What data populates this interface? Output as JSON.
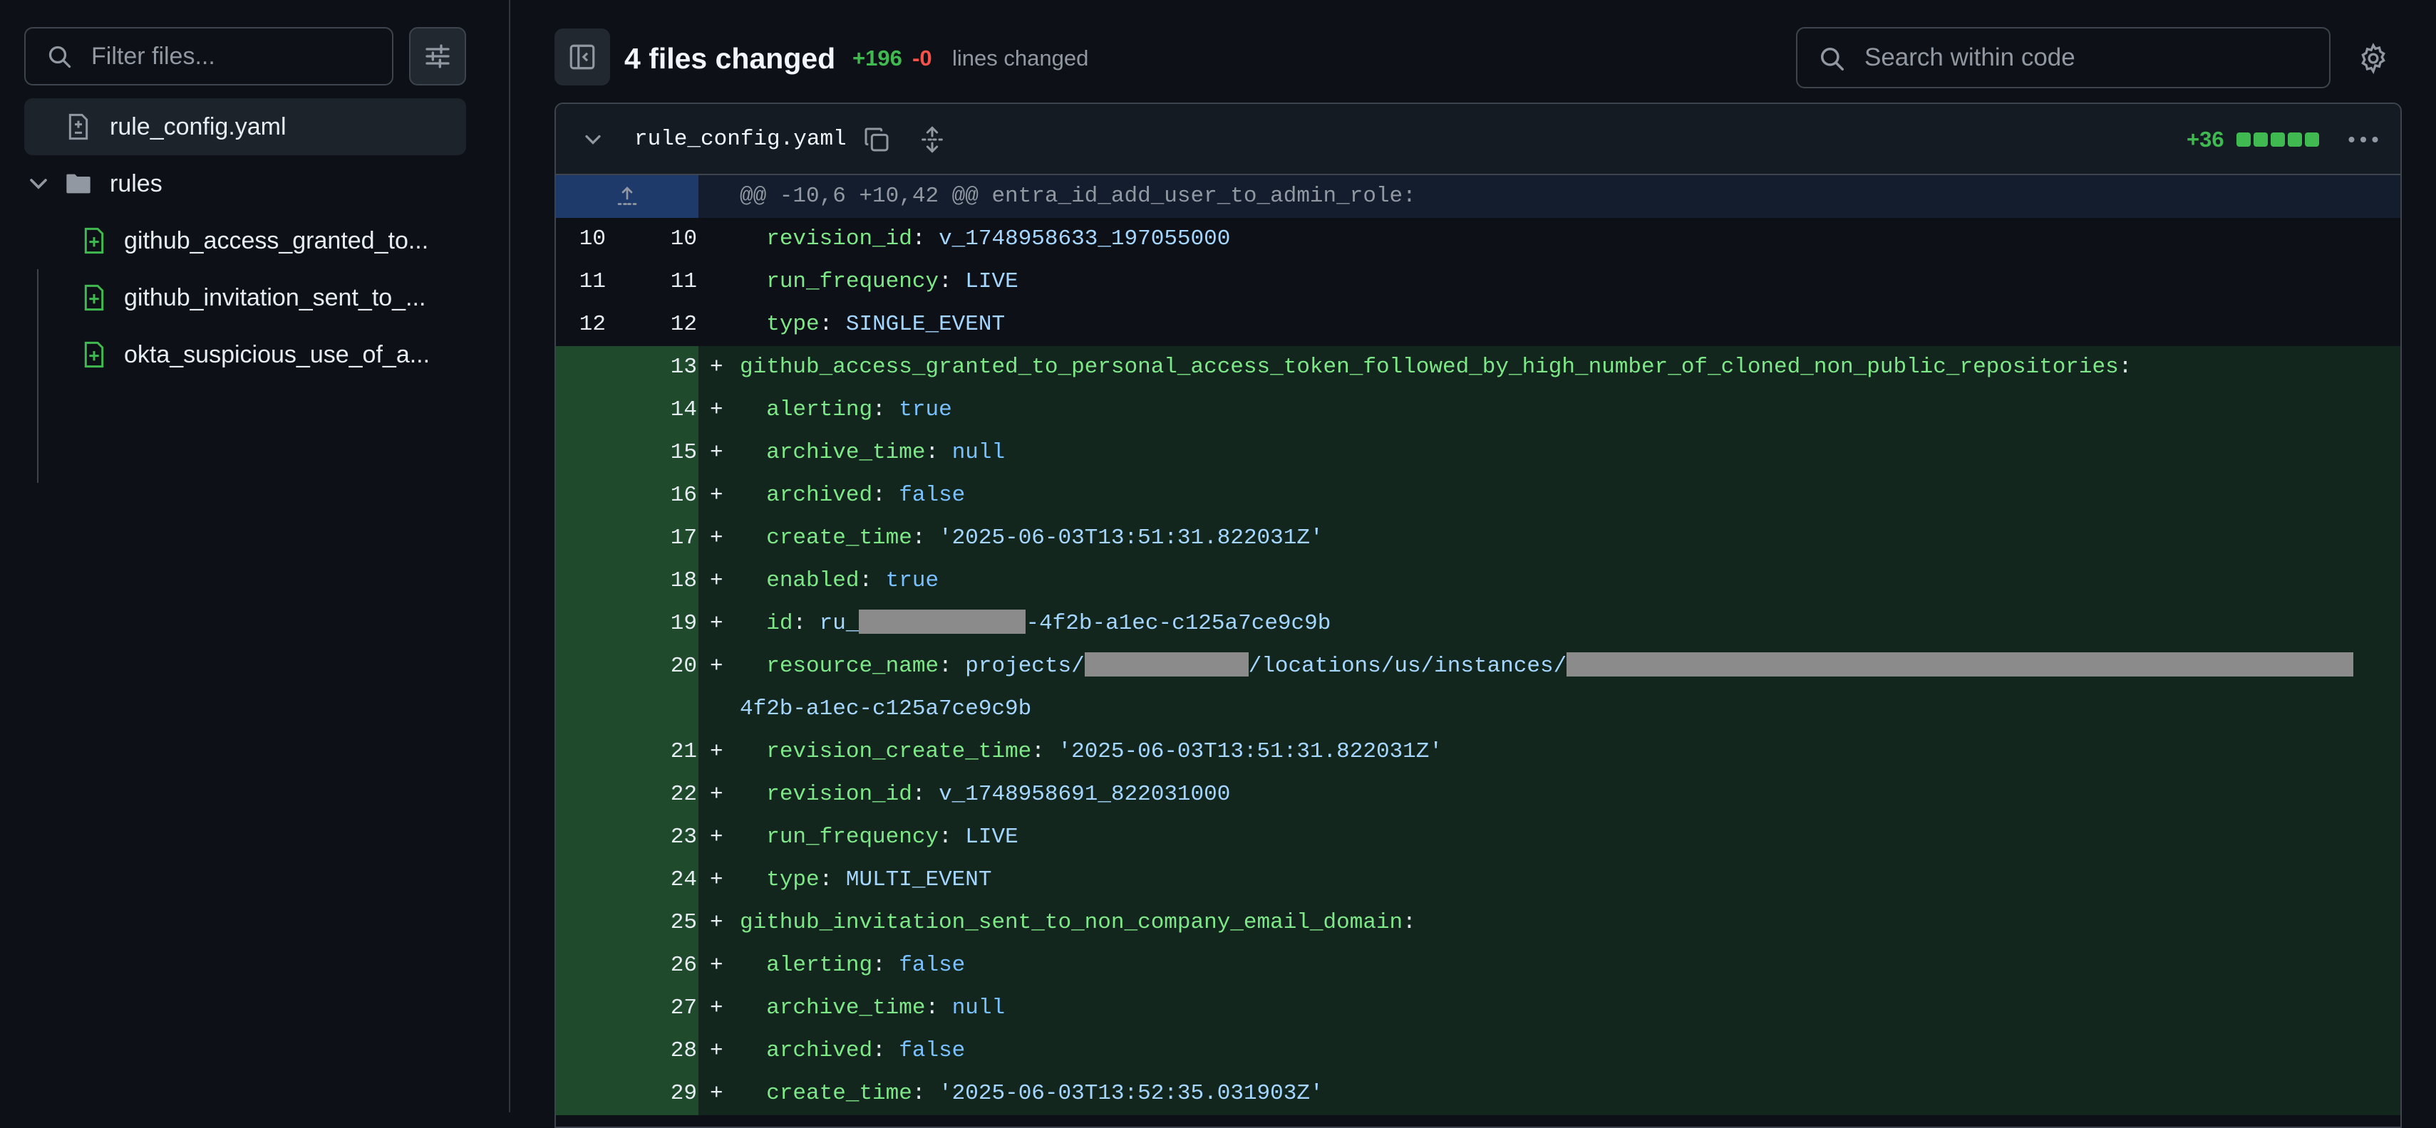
{
  "sidebar": {
    "filter_placeholder": "Filter files...",
    "files": [
      {
        "label": "rule_config.yaml",
        "icon": "file-diff-icon"
      },
      {
        "label": "rules",
        "icon": "folder-icon"
      },
      {
        "label": "github_access_granted_to...",
        "icon": "file-added-icon"
      },
      {
        "label": "github_invitation_sent_to_...",
        "icon": "file-added-icon"
      },
      {
        "label": "okta_suspicious_use_of_a...",
        "icon": "file-added-icon"
      }
    ]
  },
  "header": {
    "title": "4 files changed",
    "additions": "+196",
    "deletions": "-0",
    "lines_label": "lines changed",
    "search_placeholder": "Search within code"
  },
  "file": {
    "name": "rule_config.yaml",
    "diffstat": "+36",
    "diffstat_blocks_added": 5
  },
  "diff": {
    "hunk": "@@ -10,6 +10,42 @@ entra_id_add_user_to_admin_role:",
    "lines": [
      {
        "old": "10",
        "new": "10",
        "type": "ctx",
        "marker": "",
        "key": "revision_id",
        "value": "v_1748958633_197055000",
        "vt": "v"
      },
      {
        "old": "11",
        "new": "11",
        "type": "ctx",
        "marker": "",
        "key": "run_frequency",
        "value": "LIVE",
        "vt": "v"
      },
      {
        "old": "12",
        "new": "12",
        "type": "ctx",
        "marker": "",
        "key": "type",
        "value": "SINGLE_EVENT",
        "vt": "v"
      },
      {
        "old": "",
        "new": "13",
        "type": "add",
        "marker": "+",
        "key": "github_access_granted_to_personal_access_token_followed_by_high_number_of_cloned_non_public_repositories",
        "value": "",
        "top": true
      },
      {
        "old": "",
        "new": "14",
        "type": "add",
        "marker": "+",
        "key": "alerting",
        "value": "true",
        "vt": "n"
      },
      {
        "old": "",
        "new": "15",
        "type": "add",
        "marker": "+",
        "key": "archive_time",
        "value": "null",
        "vt": "n"
      },
      {
        "old": "",
        "new": "16",
        "type": "add",
        "marker": "+",
        "key": "archived",
        "value": "false",
        "vt": "n"
      },
      {
        "old": "",
        "new": "17",
        "type": "add",
        "marker": "+",
        "key": "create_time",
        "value": "'2025-06-03T13:51:31.822031Z'",
        "vt": "v"
      },
      {
        "old": "",
        "new": "18",
        "type": "add",
        "marker": "+",
        "key": "enabled",
        "value": "true",
        "vt": "n"
      },
      {
        "old": "",
        "new": "19",
        "type": "add",
        "marker": "+",
        "key": "id",
        "value_pre": "ru_",
        "value_post": "-4f2b-a1ec-c125a7ce9c9b",
        "redact": true
      },
      {
        "old": "",
        "new": "20",
        "type": "add",
        "marker": "+",
        "key": "resource_name",
        "value_pre": "projects/",
        "value_mid": "/locations/us/instances/",
        "redact2": true
      },
      {
        "old": "",
        "new": "",
        "type": "add",
        "marker": "",
        "wrap": "4f2b-a1ec-c125a7ce9c9b"
      },
      {
        "old": "",
        "new": "21",
        "type": "add",
        "marker": "+",
        "key": "revision_create_time",
        "value": "'2025-06-03T13:51:31.822031Z'",
        "vt": "v"
      },
      {
        "old": "",
        "new": "22",
        "type": "add",
        "marker": "+",
        "key": "revision_id",
        "value": "v_1748958691_822031000",
        "vt": "v"
      },
      {
        "old": "",
        "new": "23",
        "type": "add",
        "marker": "+",
        "key": "run_frequency",
        "value": "LIVE",
        "vt": "v"
      },
      {
        "old": "",
        "new": "24",
        "type": "add",
        "marker": "+",
        "key": "type",
        "value": "MULTI_EVENT",
        "vt": "v"
      },
      {
        "old": "",
        "new": "25",
        "type": "add",
        "marker": "+",
        "key": "github_invitation_sent_to_non_company_email_domain",
        "value": "",
        "top": true
      },
      {
        "old": "",
        "new": "26",
        "type": "add",
        "marker": "+",
        "key": "alerting",
        "value": "false",
        "vt": "n"
      },
      {
        "old": "",
        "new": "27",
        "type": "add",
        "marker": "+",
        "key": "archive_time",
        "value": "null",
        "vt": "n"
      },
      {
        "old": "",
        "new": "28",
        "type": "add",
        "marker": "+",
        "key": "archived",
        "value": "false",
        "vt": "n"
      },
      {
        "old": "",
        "new": "29",
        "type": "add",
        "marker": "+",
        "key": "create_time",
        "value": "'2025-06-03T13:52:35.031903Z'",
        "vt": "v"
      }
    ]
  }
}
